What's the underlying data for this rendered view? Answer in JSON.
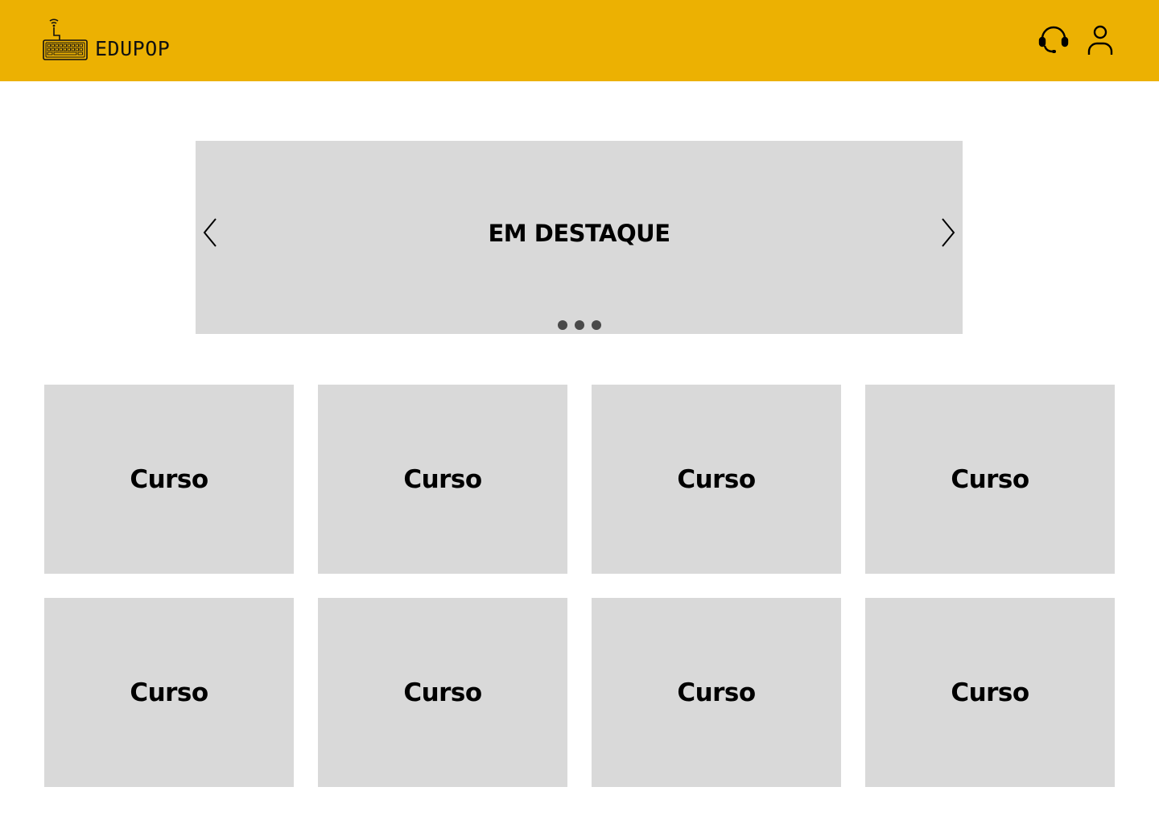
{
  "header": {
    "brand": "EDUPOP",
    "brand_color": "#ECB102",
    "logo_icon": "keyboard-wifi-icon",
    "actions": [
      {
        "name": "support",
        "icon": "headset-icon"
      },
      {
        "name": "profile",
        "icon": "user-icon"
      }
    ]
  },
  "carousel": {
    "title": "EM DESTAQUE",
    "prev_icon": "chevron-left-icon",
    "next_icon": "chevron-right-icon",
    "dot_count": 3
  },
  "courses": [
    {
      "label": "Curso"
    },
    {
      "label": "Curso"
    },
    {
      "label": "Curso"
    },
    {
      "label": "Curso"
    },
    {
      "label": "Curso"
    },
    {
      "label": "Curso"
    },
    {
      "label": "Curso"
    },
    {
      "label": "Curso"
    }
  ]
}
